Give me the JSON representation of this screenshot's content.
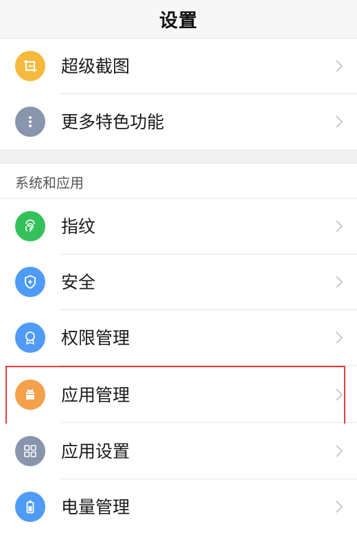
{
  "header": {
    "title": "设置"
  },
  "top_items": [
    {
      "label": "超级截图",
      "icon": "crop-icon",
      "color": "#F5B93C"
    },
    {
      "label": "更多特色功能",
      "icon": "more-icon",
      "color": "#8895AD"
    }
  ],
  "section": {
    "title": "系统和应用",
    "items": [
      {
        "label": "指纹",
        "icon": "fingerprint-icon",
        "color": "#34C15A"
      },
      {
        "label": "安全",
        "icon": "shield-icon",
        "color": "#4F9BF5"
      },
      {
        "label": "权限管理",
        "icon": "badge-icon",
        "color": "#4F9BF5"
      },
      {
        "label": "应用管理",
        "icon": "android-icon",
        "color": "#F5A04A",
        "highlighted": true
      },
      {
        "label": "应用设置",
        "icon": "grid-icon",
        "color": "#8895AD"
      },
      {
        "label": "电量管理",
        "icon": "battery-icon",
        "color": "#4F9BF5"
      }
    ]
  },
  "colors": {
    "highlight": "#E33B3B",
    "chevron": "#C4C4C4"
  }
}
